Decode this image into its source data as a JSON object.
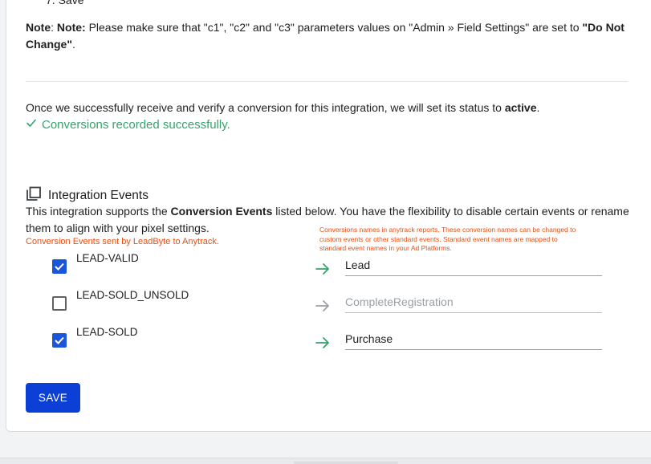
{
  "step_tail": "7. Save",
  "note": {
    "label1": "Note",
    "label2": "Note:",
    "text": " Please make sure that \"c1\", \"c2\" and \"c3\" parameters values on \"Admin » Field Settings\" are set to ",
    "bold_value": "\"Do Not Change\"",
    "end": "."
  },
  "status": {
    "text": "Once we successfully receive and verify a conversion for this integration, we will set its status to ",
    "bold": "active",
    "end": ".",
    "success": "Conversions recorded successfully."
  },
  "integration": {
    "title": "Integration Events",
    "desc_pre": "This integration supports the ",
    "desc_bold": "Conversion Events",
    "desc_post": " listed below. You have the flexibility to disable certain events or rename them to align with your pixel settings.",
    "left_hint": "Conversion Events sent by LeadByte to Anytrack.",
    "right_hint": "Conversions names in anytrack reports. These conversion names can be changed to custom events or other standard events. Standard event names are mapped to standard event names in your Ad Platforms."
  },
  "events": [
    {
      "label": "LEAD-VALID",
      "checked": true,
      "value": "Lead"
    },
    {
      "label": "LEAD-SOLD_UNSOLD",
      "checked": false,
      "value": "CompleteRegistration"
    },
    {
      "label": "LEAD-SOLD",
      "checked": true,
      "value": "Purchase"
    }
  ],
  "save_label": "SAVE",
  "colors": {
    "accent": "#1a56db",
    "save_button": "#0b3fd6",
    "success": "#34a36b",
    "hint": "#ea4e12",
    "arrow": "#34a36b"
  },
  "icons": {
    "success": "check-icon",
    "section": "copy-stack-icon",
    "arrow": "arrow-right-icon"
  }
}
